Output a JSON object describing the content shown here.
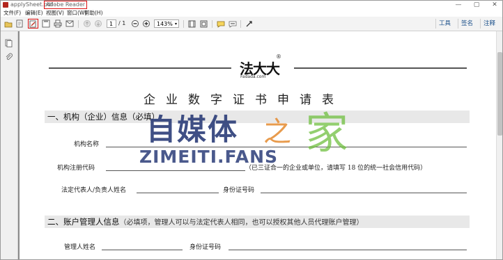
{
  "window": {
    "title_prefix": "applySheet.pdf - ",
    "title_app": "Adobe Reader",
    "controls": [
      "—",
      "▢",
      "✕"
    ]
  },
  "menu": [
    "文件(F)",
    "编辑(E)",
    "视图(V)",
    "窗口(W)",
    "帮助(H)"
  ],
  "toolbar": {
    "page_current": "1",
    "page_total": "/ 1",
    "zoom": "143%",
    "right_buttons": [
      "工具",
      "签名",
      "注释"
    ],
    "highlight_color": "#d11"
  },
  "document": {
    "logo_text": "法大大",
    "logo_sub": "Fadada.com",
    "logo_reg": "®",
    "title": "企业数字证书申请表",
    "section1": {
      "title": "一、机构（企业）信息（必填）"
    },
    "org_name_label": "机构名称",
    "org_code_label": "机构注册代码",
    "org_code_note": "（已三证合一的企业或单位，请填写 18 位的统一社会信用代码）",
    "legal_rep_label": "法定代表人/负责人姓名",
    "id_label": "身份证号码",
    "section2": {
      "title": "二、账户管理人信息",
      "note": "（必填项，管理人可以与法定代表人相同，也可以授权其他人员代理账户管理）"
    },
    "manager_label": "管理人姓名",
    "manager_id_label": "身份证号码"
  },
  "watermark": {
    "cn": "自媒体",
    "zhi": "之",
    "jia": "家",
    "en": "ZIMEITI.FANS"
  }
}
